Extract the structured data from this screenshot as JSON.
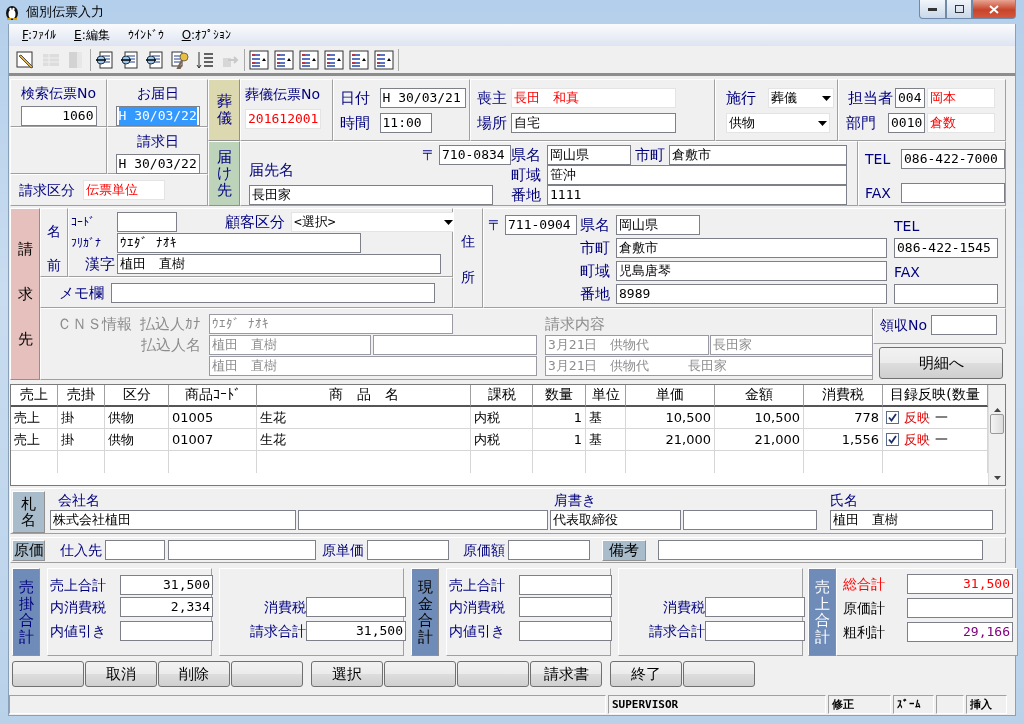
{
  "window": {
    "title": "個別伝票入力"
  },
  "menu": [
    {
      "accel": "F",
      "label": ":ﾌｧｲﾙ"
    },
    {
      "accel": "E",
      "label": ":編集"
    },
    {
      "label": "ｳｲﾝﾄﾞｳ"
    },
    {
      "accel": "O",
      "label": ":ｵﾌﾟｼｮﾝ"
    }
  ],
  "toolbar": [
    [
      {
        "kind": "pencil",
        "disabled": false
      },
      {
        "kind": "table",
        "disabled": true
      },
      {
        "kind": "column",
        "disabled": true
      }
    ],
    [
      {
        "kind": "doc",
        "disabled": false
      },
      {
        "kind": "doc",
        "disabled": false
      },
      {
        "kind": "doc",
        "disabled": false
      },
      {
        "kind": "key",
        "disabled": false
      },
      {
        "kind": "sort",
        "disabled": false
      },
      {
        "kind": "export",
        "disabled": true
      }
    ],
    [
      {
        "kind": "list",
        "disabled": false
      },
      {
        "kind": "list",
        "disabled": false
      },
      {
        "kind": "list",
        "disabled": false
      },
      {
        "kind": "list",
        "disabled": false
      },
      {
        "kind": "list",
        "disabled": false
      },
      {
        "kind": "list",
        "disabled": false
      }
    ]
  ],
  "slip_search": {
    "label": "検索伝票No",
    "value": "1060"
  },
  "delivery_date": {
    "label": "お届日",
    "value": "H 30/03/22",
    "focused": true
  },
  "billing_date": {
    "label": "請求日",
    "value": "H 30/03/22",
    "focused": false
  },
  "billing_type": {
    "label": "請求区分",
    "value": "伝票単位"
  },
  "funeral": {
    "tag": "葬儀",
    "slip_label": "葬儀伝票No",
    "slip_no": "201612001",
    "date_label": "日付",
    "date": "H 30/03/21",
    "time_label": "時間",
    "time": "11:00",
    "mourner_label": "喪主",
    "mourner": "長田　和真",
    "place_label": "場所",
    "place": "自宅",
    "service_label": "施行",
    "service": "葬儀",
    "item_type": "供物",
    "staff_label": "担当者",
    "staff_code": "004",
    "staff_name": "岡本",
    "dept_label": "部門",
    "dept_code": "0010",
    "dept_name": "倉数"
  },
  "delivery": {
    "tag": "届け先",
    "name_label": "届先名",
    "name": "長田家",
    "postal_mark": "〒",
    "postal": "710-0834",
    "pref_label": "県名",
    "pref": "岡山県",
    "city_label": "市町",
    "city": "倉敷市",
    "town_label": "町域",
    "town": "笹沖",
    "lot_label": "番地",
    "lot": "1111",
    "tel_label": "TEL",
    "tel": "086-422-7000",
    "fax_label": "FAX"
  },
  "billing": {
    "tag": "請求先",
    "name_tag": "名前",
    "code_label": "ｺｰﾄﾞ",
    "customer_type_label": "顧客区分",
    "customer_type": "<選択>",
    "kana_label": "ﾌﾘｶﾞﾅ",
    "kana": "ｳｴﾀﾞ ﾅｵｷ",
    "kanji_label": "漢字",
    "kanji": "植田　直樹",
    "memo_label": "メモ欄",
    "address_tag": "住所",
    "postal_mark": "〒",
    "postal": "711-0904",
    "pref_label": "県名",
    "pref": "岡山県",
    "city_label": "市町",
    "city": "倉敷市",
    "town_label": "町域",
    "town": "児島唐琴",
    "lot_label": "番地",
    "lot": "8989",
    "tel_label": "TEL",
    "tel": "086-422-1545",
    "fax_label": "FAX"
  },
  "cns": {
    "disabled": true,
    "label": "ＣＮＳ情報",
    "payer_kana_label": "払込人ｶﾅ",
    "payer_kana": "ｳｴﾀﾞ ﾅｵｷ",
    "payer_name_label": "払込人名",
    "payer_name_1": "植田　直樹",
    "payer_name_2": "植田　直樹",
    "content_label": "請求内容",
    "content_1": "3月21日　供物代",
    "content_1_to": "長田家",
    "content_2": "3月21日　供物代　　　長田家"
  },
  "receipt": {
    "label": "領収No"
  },
  "detail_button": "明細へ",
  "table": {
    "columns": [
      "売上",
      "売掛",
      "区分",
      "商品ｺｰﾄﾞ",
      "商　品　名",
      "課税",
      "数量",
      "単位",
      "単価",
      "金額",
      "消費税",
      "目録反映(数量"
    ],
    "rows": [
      {
        "cells": [
          "売上",
          "掛",
          "供物",
          "01005",
          "生花",
          "内税",
          "1",
          "基",
          "10,500",
          "10,500",
          "778"
        ],
        "checked": true,
        "reflect": "反映",
        "qty": "一"
      },
      {
        "cells": [
          "売上",
          "掛",
          "供物",
          "01007",
          "生花",
          "内税",
          "1",
          "基",
          "21,000",
          "21,000",
          "1,556"
        ],
        "checked": true,
        "reflect": "反映",
        "qty": "一"
      }
    ]
  },
  "tag_name": {
    "tag": "札名",
    "company_label": "会社名",
    "company": "株式会社植田",
    "title_label": "肩書き",
    "title": "代表取締役",
    "person_label": "氏名",
    "person": "植田　直樹"
  },
  "cost": {
    "tag": "原価",
    "supplier_label": "仕入先",
    "unit_cost_label": "原単価",
    "amount_label": "原価額",
    "note_tag": "備考"
  },
  "totals": {
    "credit": {
      "tag": "売掛合計",
      "rows": [
        {
          "label": "売上合計",
          "value": "31,500"
        },
        {
          "label": "内消費税",
          "value": "2,334"
        },
        {
          "label": "内値引き"
        }
      ],
      "tax_label": "消費税",
      "billed_label": "請求合計",
      "billed": "31,500"
    },
    "cash": {
      "tag": "現金合計",
      "rows": [
        {
          "label": "売上合計"
        },
        {
          "label": "内消費税"
        },
        {
          "label": "内値引き"
        }
      ],
      "tax_label": "消費税",
      "billed_label": "請求合計"
    },
    "sales": {
      "tag": "売上合計",
      "rows": [
        {
          "kind": "grand",
          "label": "総合計",
          "value": "31,500"
        },
        {
          "kind": "plain",
          "label": "原価計"
        },
        {
          "kind": "profit",
          "label": "粗利計",
          "value": "29,166"
        }
      ]
    }
  },
  "buttons": [
    {
      "kind": "blank"
    },
    {
      "kind": "action",
      "label": "取消"
    },
    {
      "kind": "action",
      "label": "削除"
    },
    {
      "kind": "blank"
    },
    {
      "kind": "action",
      "label": "選択"
    },
    {
      "kind": "blank"
    },
    {
      "kind": "blank"
    },
    {
      "kind": "action",
      "label": "請求書"
    },
    {
      "kind": "action",
      "label": "終了"
    },
    {
      "kind": "blank"
    }
  ],
  "status_bar": [
    {
      "kind": "blank"
    },
    {
      "kind": "text",
      "text": "SUPERVISOR"
    },
    {
      "kind": "text",
      "text": "修正"
    },
    {
      "kind": "text",
      "text": "ｽﾞｰﾑ"
    },
    {
      "kind": "blank"
    },
    {
      "kind": "text",
      "text": "挿入"
    }
  ]
}
